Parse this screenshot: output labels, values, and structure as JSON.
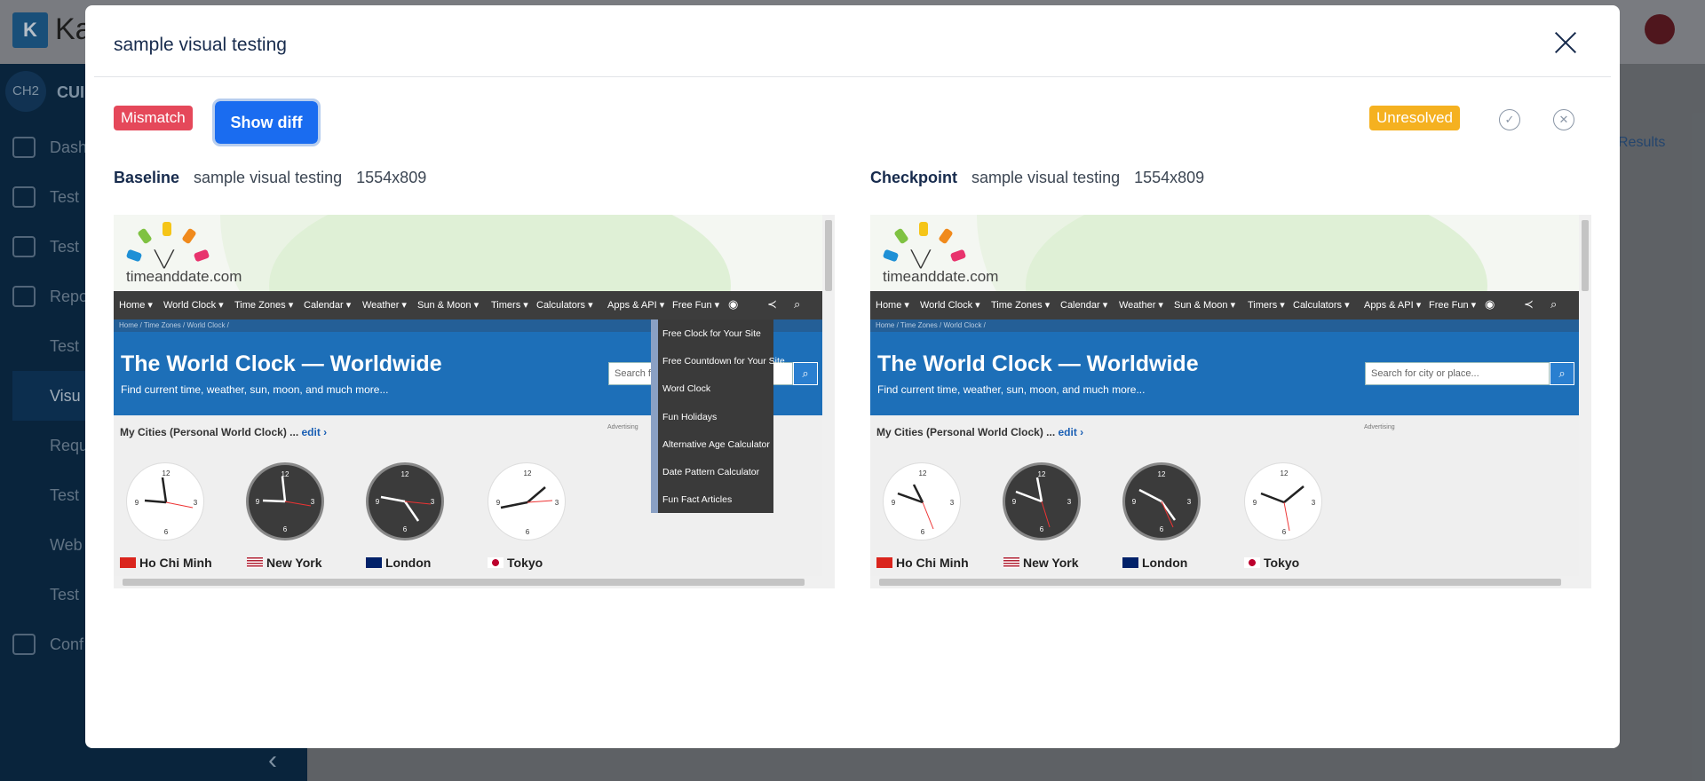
{
  "modal": {
    "title": "sample visual testing",
    "mismatch_label": "Mismatch",
    "show_diff_label": "Show diff",
    "unresolved_label": "Unresolved"
  },
  "panels": [
    {
      "kind": "Baseline",
      "name": "sample visual testing",
      "size": "1554x809"
    },
    {
      "kind": "Checkpoint",
      "name": "sample visual testing",
      "size": "1554x809"
    }
  ],
  "site": {
    "logo_text": "timeanddate.com",
    "nav": [
      "Home ▾",
      "World Clock ▾",
      "Time Zones ▾",
      "Calendar ▾",
      "Weather ▾",
      "Sun & Moon ▾",
      "Timers ▾",
      "Calculators ▾",
      "Apps & API ▾",
      "Free Fun ▾"
    ],
    "breadcrumb": "Home / Time Zones / World Clock /",
    "heading": "The World Clock — Worldwide",
    "subheading": "Find current time, weather, sun, moon, and much more...",
    "search_placeholder": "Search for city or place...",
    "baseline_search_text": "Search for",
    "cities_label": "My Cities (Personal World Clock) ...",
    "edit_label": "edit ›",
    "advertising": "Advertising",
    "cities": [
      "Ho Chi Minh",
      "New York",
      "London",
      "Tokyo"
    ],
    "dropdown": [
      "Free Clock for Your Site",
      "Free Countdown for Your Site",
      "Word Clock",
      "Fun Holidays",
      "Alternative Age Calculator",
      "Date Pattern Calculator",
      "Fun Fact Articles"
    ]
  },
  "background": {
    "app_title": "Ka",
    "logo_letter": "K",
    "project_badge": "CH2",
    "project_name": "CUI",
    "sidebar": [
      "Dash",
      "Test",
      "Test",
      "Repo",
      "Test",
      "Visu",
      "Requ",
      "Test",
      "Web",
      "Test",
      "Conf"
    ],
    "results_link": "Results"
  },
  "colors": {
    "mismatch": "#e5485a",
    "show_diff": "#1a6cf0",
    "unresolved": "#f5b120",
    "site_blue": "#1d6fb8"
  }
}
